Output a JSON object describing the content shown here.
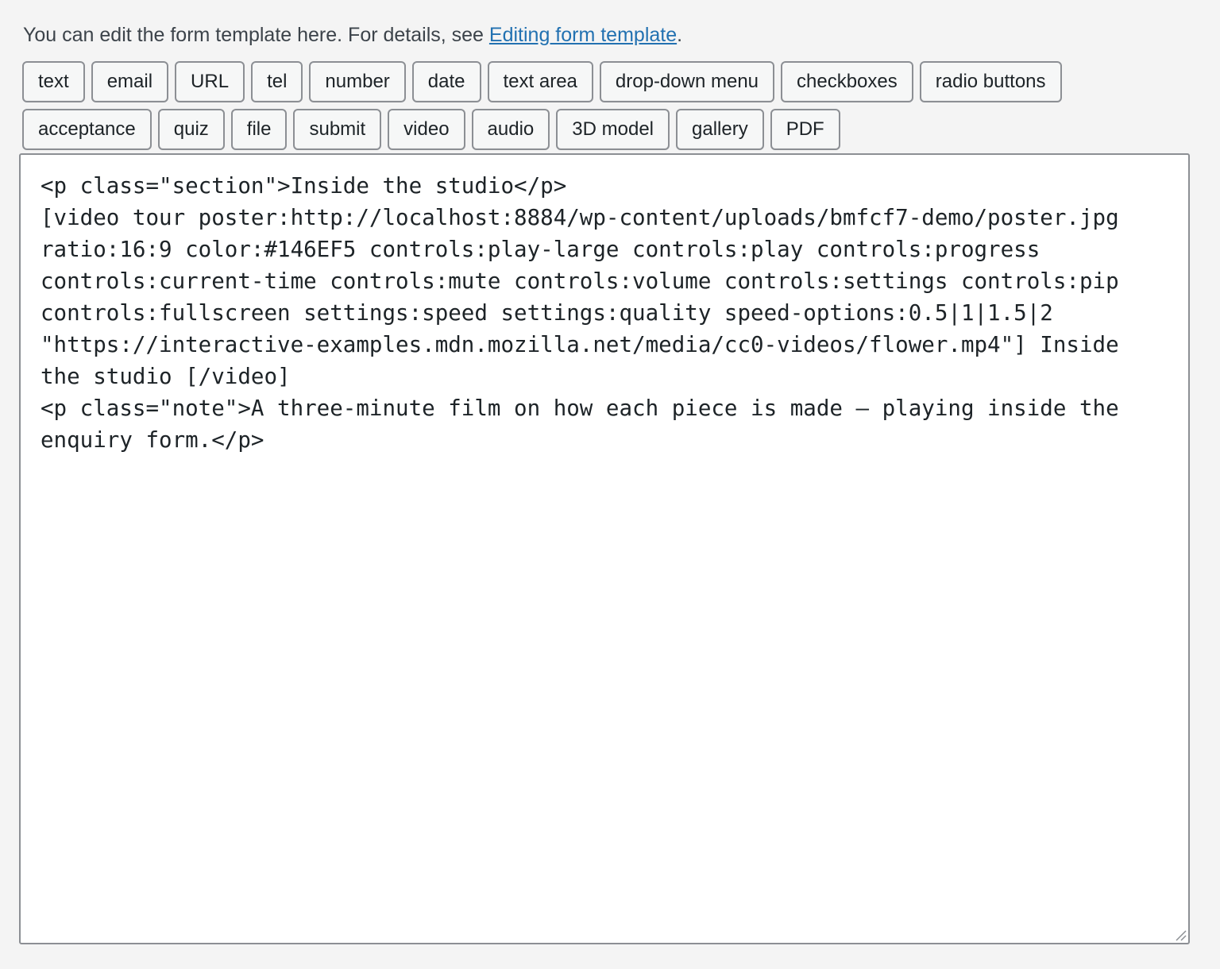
{
  "intro": {
    "text_before": "You can edit the form template here. For details, see ",
    "link_text": "Editing form template",
    "text_after": "."
  },
  "tag_buttons_row1": [
    {
      "label": "text",
      "name": "tag-button-text"
    },
    {
      "label": "email",
      "name": "tag-button-email"
    },
    {
      "label": "URL",
      "name": "tag-button-url"
    },
    {
      "label": "tel",
      "name": "tag-button-tel"
    },
    {
      "label": "number",
      "name": "tag-button-number"
    },
    {
      "label": "date",
      "name": "tag-button-date"
    },
    {
      "label": "text area",
      "name": "tag-button-text-area"
    },
    {
      "label": "drop-down menu",
      "name": "tag-button-drop-down-menu"
    },
    {
      "label": "checkboxes",
      "name": "tag-button-checkboxes"
    },
    {
      "label": "radio buttons",
      "name": "tag-button-radio-buttons"
    }
  ],
  "tag_buttons_row2": [
    {
      "label": "acceptance",
      "name": "tag-button-acceptance"
    },
    {
      "label": "quiz",
      "name": "tag-button-quiz"
    },
    {
      "label": "file",
      "name": "tag-button-file"
    },
    {
      "label": "submit",
      "name": "tag-button-submit"
    },
    {
      "label": "video",
      "name": "tag-button-video"
    },
    {
      "label": "audio",
      "name": "tag-button-audio"
    },
    {
      "label": "3D model",
      "name": "tag-button-3d-model"
    },
    {
      "label": "gallery",
      "name": "tag-button-gallery"
    },
    {
      "label": "PDF",
      "name": "tag-button-pdf"
    }
  ],
  "editor": {
    "value": "<p class=\"section\">Inside the studio</p>\n[video tour poster:http://localhost:8884/wp-content/uploads/bmfcf7-demo/poster.jpg ratio:16:9 color:#146EF5 controls:play-large controls:play controls:progress controls:current-time controls:mute controls:volume controls:settings controls:pip controls:fullscreen settings:speed settings:quality speed-options:0.5|1|1.5|2 \"https://interactive-examples.mdn.mozilla.net/media/cc0-videos/flower.mp4\"] Inside the studio [/video]\n<p class=\"note\">A three-minute film on how each piece is made — playing inside the enquiry form.</p>"
  }
}
